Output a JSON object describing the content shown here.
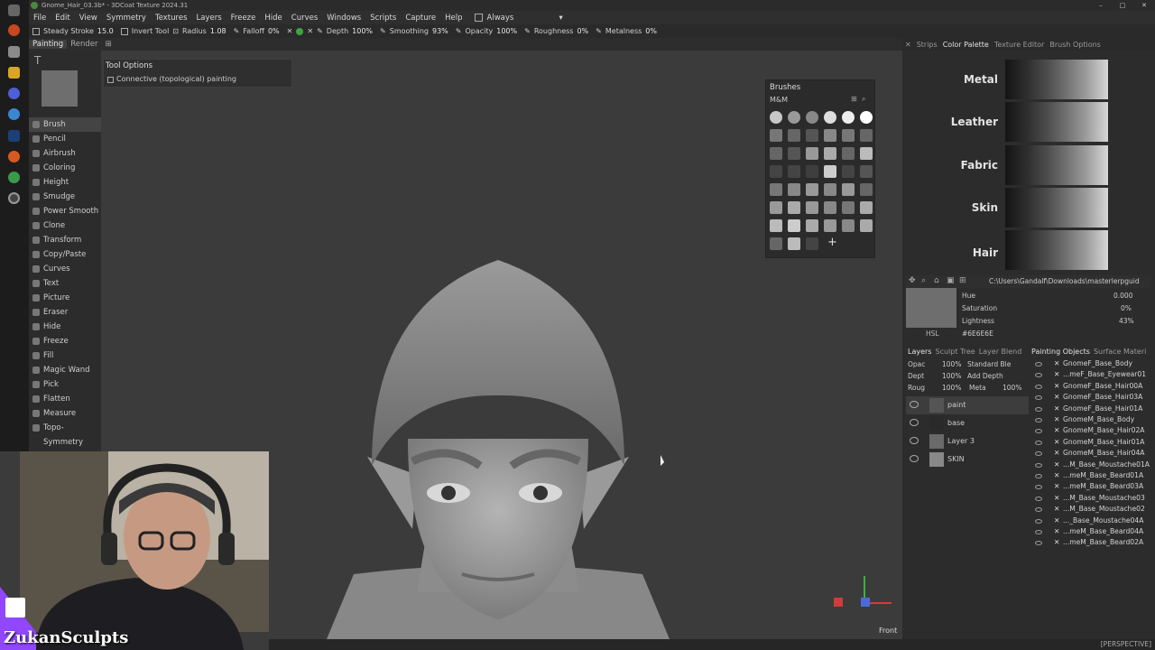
{
  "window": {
    "title": "Gnome_Hair_03.3b* - 3DCoat Texture 2024.31"
  },
  "menu": [
    "File",
    "Edit",
    "View",
    "Symmetry",
    "Textures",
    "Layers",
    "Freeze",
    "Hide",
    "Curves",
    "Windows",
    "Scripts",
    "Capture",
    "Help"
  ],
  "menu_always": "Always",
  "toolbar": {
    "steady_stroke": "Steady Stroke",
    "steady_value": "15.0",
    "invert_tool": "Invert Tool",
    "radius": "Radius",
    "radius_value": "1.08",
    "falloff": "Falloff",
    "falloff_value": "0%",
    "depth": "Depth",
    "depth_value": "100%",
    "smoothing": "Smoothing",
    "smoothing_value": "93%",
    "opacity": "Opacity",
    "opacity_value": "100%",
    "roughness": "Roughness",
    "roughness_value": "0%",
    "metalness": "Metalness",
    "metalness_value": "0%"
  },
  "room_tabs": [
    "Painting",
    "Render"
  ],
  "tools": [
    "Brush",
    "Pencil",
    "Airbrush",
    "Coloring",
    "Height",
    "Smudge",
    "Power Smooth",
    "Clone",
    "Transform",
    "Copy/Paste",
    "Curves",
    "Text",
    "Picture",
    "Eraser",
    "Hide",
    "Freeze",
    "Fill",
    "Magic Wand",
    "Pick",
    "Flatten",
    "Measure",
    "Topo-Symmetry"
  ],
  "tool_options": {
    "title": "Tool Options",
    "connective": "Connective (topological) painting"
  },
  "brushes": {
    "title": "Brushes",
    "set": "M&M"
  },
  "right_tabs": [
    "Strips",
    "Color Palette",
    "Texture Editor",
    "Brush Options"
  ],
  "palette": [
    "Metal",
    "Leather",
    "Fabric",
    "Skin",
    "Hair"
  ],
  "color_path": "C:\\Users\\Gandalf\\Downloads\\masterlerpguid",
  "hsl": {
    "mode": "HSL",
    "hex": "#6E6E6E",
    "hue_label": "Hue",
    "hue": "0.000",
    "saturation_label": "Saturation",
    "saturation": "0%",
    "lightness_label": "Lightness",
    "lightness": "43%"
  },
  "layers_tabs": [
    "Layers",
    "Sculpt Tree",
    "Layer Blend"
  ],
  "layer_controls": {
    "opac": "Opac",
    "opac_val": "100%",
    "blend": "Standard Ble",
    "dept": "Dept",
    "dept_val": "100%",
    "depth_mode": "Add Depth",
    "roug": "Roug",
    "roug_val": "100%",
    "meta": "Meta",
    "meta_val": "100%"
  },
  "layers": [
    "paint",
    "base",
    "Layer 3",
    "SKIN"
  ],
  "objects_tabs": [
    "Painting Objects",
    "Surface Materi"
  ],
  "objects": [
    "GnomeF_Base_Body",
    "...meF_Base_Eyewear01",
    "GnomeF_Base_Hair00A",
    "GnomeF_Base_Hair03A",
    "GnomeF_Base_Hair01A",
    "GnomeM_Base_Body",
    "GnomeM_Base_Hair02A",
    "GnomeM_Base_Hair01A",
    "GnomeM_Base_Hair04A",
    "...M_Base_Moustache01A",
    "...meM_Base_Beard01A",
    "...meM_Base_Beard03A",
    "...M_Base_Moustache03",
    "...M_Base_Moustache02",
    "..._Base_Moustache04A",
    "...meM_Base_Beard04A",
    "...meM_Base_Beard02A"
  ],
  "view": {
    "label": "Front",
    "perspective": "[PERSPECTIVE]"
  },
  "streamer": "ZukanSculpts"
}
